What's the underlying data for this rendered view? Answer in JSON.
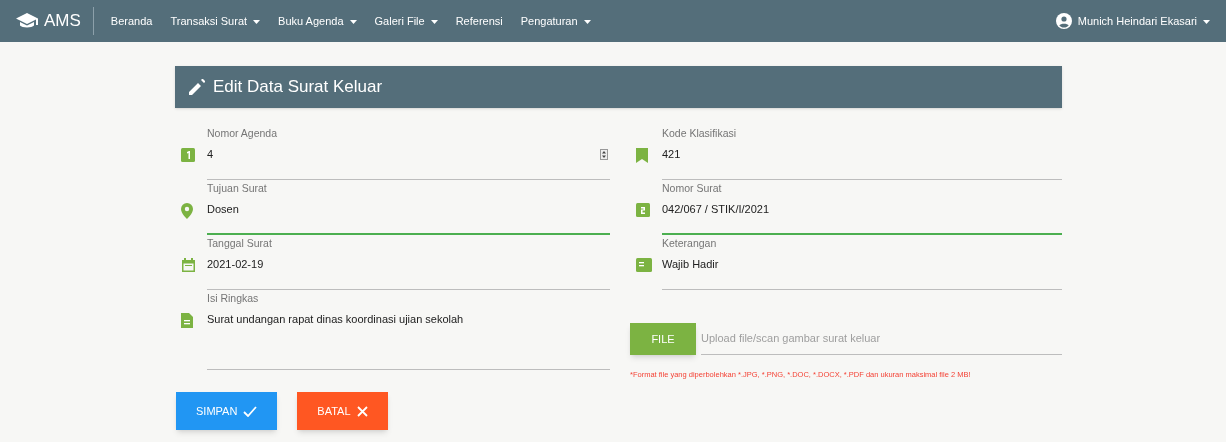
{
  "navbar": {
    "brand": "AMS",
    "menu": [
      {
        "label": "Beranda",
        "dropdown": false
      },
      {
        "label": "Transaksi Surat",
        "dropdown": true
      },
      {
        "label": "Buku Agenda",
        "dropdown": true
      },
      {
        "label": "Galeri File",
        "dropdown": true
      },
      {
        "label": "Referensi",
        "dropdown": false
      },
      {
        "label": "Pengaturan",
        "dropdown": true
      }
    ],
    "user": {
      "name": "Munich Heindari Ekasari",
      "dropdown": true
    }
  },
  "form": {
    "title": "Edit Data Surat Keluar",
    "left": [
      {
        "kind": "agenda-number",
        "label": "Nomor Agenda",
        "value": "4",
        "active": false
      },
      {
        "kind": "destination",
        "label": "Tujuan Surat",
        "value": "Dosen",
        "active": true
      },
      {
        "kind": "date",
        "label": "Tanggal Surat",
        "value": "2021-02-19",
        "active": false
      },
      {
        "kind": "summary",
        "label": "Isi Ringkas",
        "value": "Surat undangan rapat dinas koordinasi ujian sekolah",
        "active": false
      }
    ],
    "right": [
      {
        "kind": "classification",
        "label": "Kode Klasifikasi",
        "value": "421",
        "active": false
      },
      {
        "kind": "letter-number",
        "label": "Nomor Surat",
        "value": "042/067 / STIK/I/2021",
        "active": true
      },
      {
        "kind": "notes",
        "label": "Keterangan",
        "value": "Wajib Hadir",
        "active": false
      }
    ],
    "file": {
      "button": "FILE",
      "placeholder": "Upload file/scan gambar surat keluar",
      "hint": "*Format file yang diperbolehkan *.JPG, *.PNG, *.DOC, *.DOCX, *.PDF dan ukuran maksimal file 2 MB!"
    },
    "buttons": [
      {
        "label": "SIMPAN",
        "kind": "save"
      },
      {
        "label": "BATAL",
        "kind": "cancel"
      }
    ]
  }
}
